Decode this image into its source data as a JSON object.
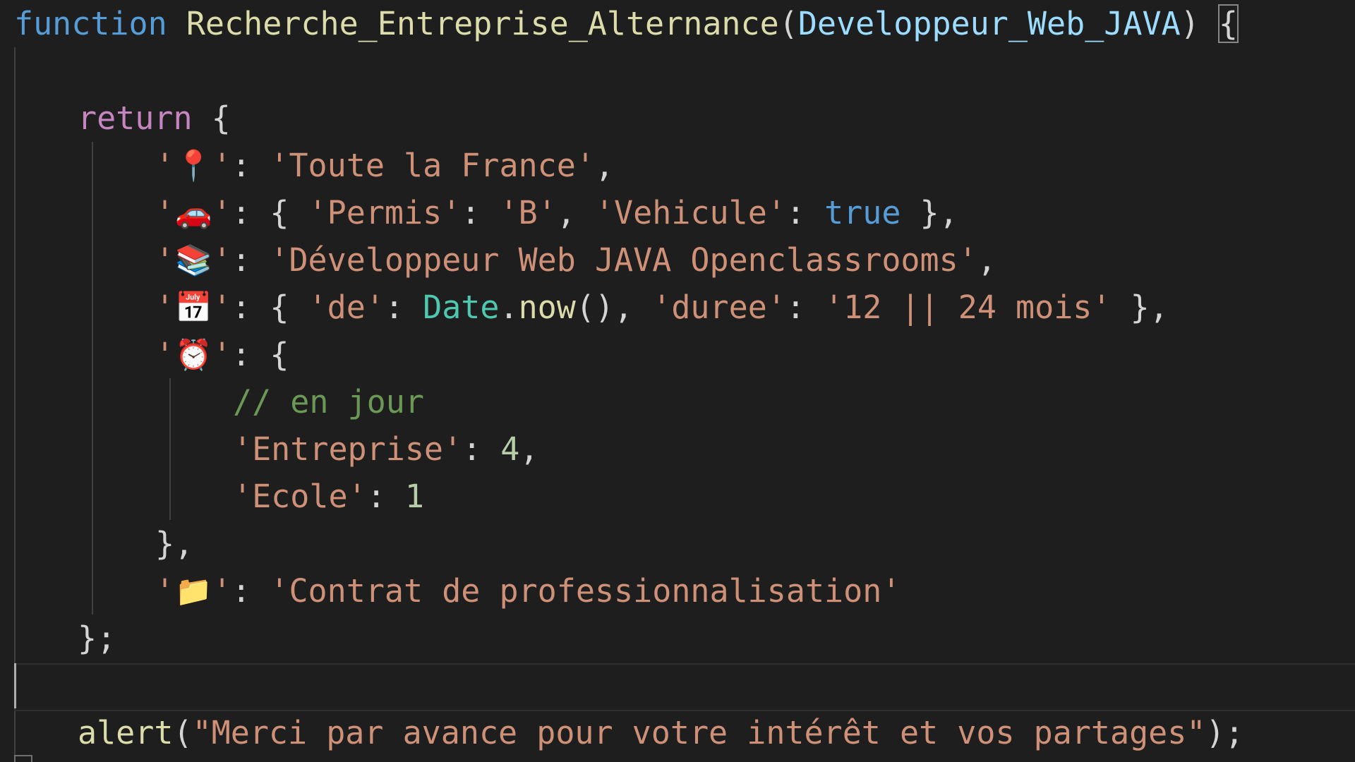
{
  "code": {
    "function_keyword": "function",
    "function_name": "Recherche_Entreprise_Alternance",
    "param": "Developpeur_Web_JAVA",
    "return_keyword": "return",
    "pin_emoji": "📍",
    "location": "'Toute la France'",
    "car_emoji": "🚗",
    "permis_key": "'Permis'",
    "permis_value": "'B'",
    "vehicule_key": "'Vehicule'",
    "vehicule_value": "true",
    "books_emoji": "📚",
    "formation": "'Développeur Web JAVA Openclassrooms'",
    "calendar_emoji": "📅",
    "de_key": "'de'",
    "date_type": "Date",
    "now_method": "now",
    "duree_key": "'duree'",
    "duree_value": "'12 || 24 mois'",
    "clock_emoji": "⏰",
    "comment": "// en jour",
    "entreprise_key": "'Entreprise'",
    "entreprise_value": "4",
    "ecole_key": "'Ecole'",
    "ecole_value": "1",
    "folder_emoji": "📁",
    "contrat": "'Contrat de professionnalisation'",
    "alert_fn": "alert",
    "alert_message": "\"Merci par avance pour votre intérêt et vos partages\""
  }
}
